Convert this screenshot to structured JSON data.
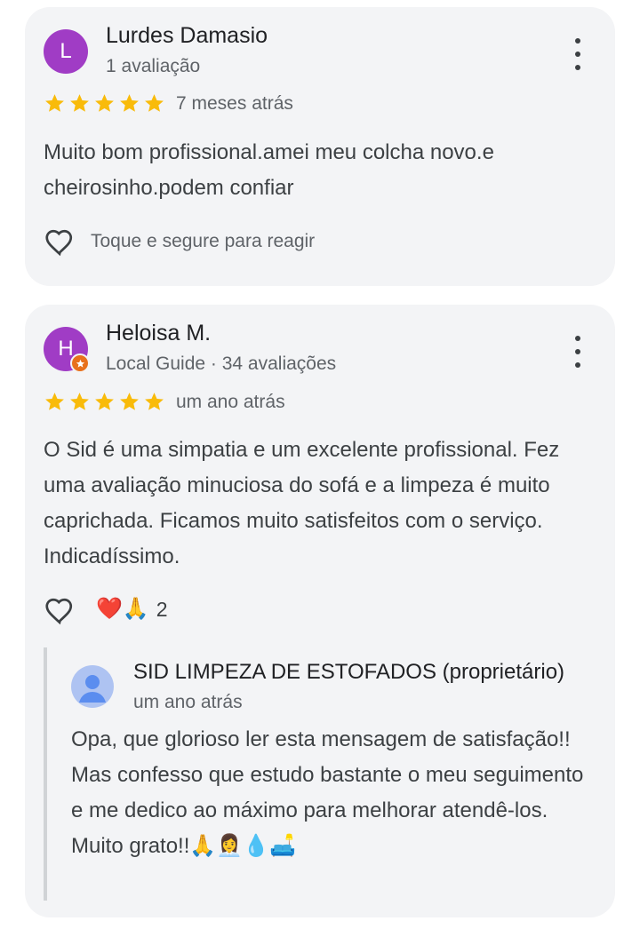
{
  "reviews": [
    {
      "avatar_letter": "L",
      "name": "Lurdes Damasio",
      "meta": "1 avaliação",
      "rating": 5,
      "time": "7 meses atrás",
      "text": "Muito bom profissional.amei meu colcha novo.e cheirosinho.podem confiar",
      "react_prompt": "Toque e segure para reagir"
    },
    {
      "avatar_letter": "H",
      "name": "Heloisa M.",
      "meta": "Local Guide · 34 avaliações",
      "rating": 5,
      "time": "um ano atrás",
      "text": "O Sid é uma simpatia e um excelente profissional. Fez uma avaliação minuciosa do sofá e a limpeza é muito caprichada. Ficamos muito satisfeitos com o serviço. Indicadíssimo.",
      "reactions": {
        "emojis": "❤️🙏",
        "count": "2"
      },
      "owner_reply": {
        "name": "SID LIMPEZA DE ESTOFADOS (proprietário)",
        "time": "um ano atrás",
        "text": "Opa, que glorioso ler esta mensagem de satisfação!! Mas confesso que estudo bastante o meu seguimento e me dedico ao máximo para melhorar atendê-los. Muito grato!!🙏👩‍💼💧🛋️"
      }
    }
  ],
  "icons": {
    "star_color": "#f9bb0a",
    "avatar_color": "#a03cc5",
    "badge_color": "#e8711c",
    "owner_avatar_color": "#aec3f2",
    "owner_avatar_figure_color": "#5b8def"
  }
}
